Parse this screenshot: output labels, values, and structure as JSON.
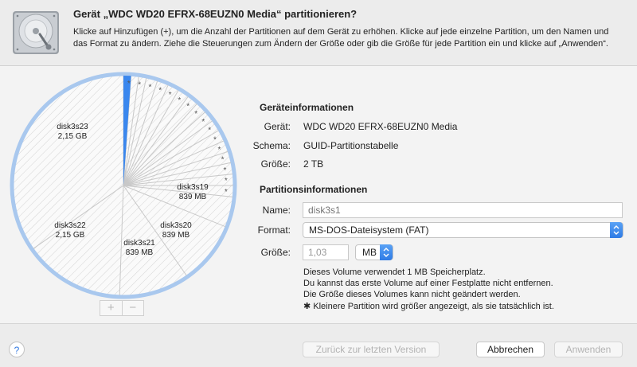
{
  "header": {
    "title": "Gerät „WDC WD20 EFRX-68EUZN0 Media“ partitionieren?",
    "description": "Klicke auf Hinzufügen (+), um die Anzahl der Partitionen auf dem Gerät zu erhöhen. Klicke auf jede einzelne Partition, um den Namen und das Format zu ändern. Ziehe die Steuerungen zum Ändern der Größe oder gib die Größe für jede Partition ein und klicke auf „Anwenden“."
  },
  "pie": {
    "labels": [
      {
        "name": "disk3s23",
        "size": "2,15 GB"
      },
      {
        "name": "disk3s22",
        "size": "2,15 GB"
      },
      {
        "name": "disk3s21",
        "size": "839 MB"
      },
      {
        "name": "disk3s20",
        "size": "839 MB"
      },
      {
        "name": "disk3s19",
        "size": "839 MB"
      }
    ],
    "small_marker": "*",
    "selected_color": "#3a87ee",
    "ring_color": "#a9c8ee",
    "add_label": "+",
    "remove_label": "−"
  },
  "device_info": {
    "title": "Geräteinformationen",
    "device_label": "Gerät:",
    "device_value": "WDC WD20 EFRX-68EUZN0 Media",
    "scheme_label": "Schema:",
    "scheme_value": "GUID-Partitionstabelle",
    "size_label": "Größe:",
    "size_value": "2 TB"
  },
  "partition_info": {
    "title": "Partitionsinformationen",
    "name_label": "Name:",
    "name_placeholder": "disk3s1",
    "format_label": "Format:",
    "format_value": "MS-DOS-Dateisystem (FAT)",
    "size_label": "Größe:",
    "size_value": "1,03",
    "unit_value": "MB",
    "note_lines": [
      "Dieses Volume verwendet 1 MB Speicherplatz.",
      "Du kannst das erste Volume auf einer Festplatte nicht entfernen.",
      "Die Größe dieses Volumes kann nicht geändert werden."
    ],
    "footnote": "✱ Kleinere Partition wird größer angezeigt, als sie tatsächlich ist."
  },
  "footer": {
    "help_label": "?",
    "revert_label": "Zurück zur letzten Version",
    "cancel_label": "Abbrechen",
    "apply_label": "Anwenden"
  }
}
